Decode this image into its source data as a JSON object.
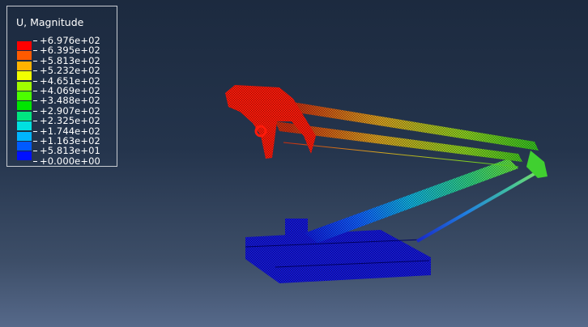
{
  "legend": {
    "title": "U, Magnitude",
    "colors": [
      "#ff0000",
      "#ff5a00",
      "#ffb300",
      "#f2ff00",
      "#a0ff00",
      "#4cff00",
      "#00e600",
      "#00e680",
      "#00e0e0",
      "#00b4ff",
      "#005aff",
      "#0010ff"
    ],
    "values": [
      "+6.976e+02",
      "+6.395e+02",
      "+5.813e+02",
      "+5.232e+02",
      "+4.651e+02",
      "+4.069e+02",
      "+3.488e+02",
      "+2.907e+02",
      "+2.325e+02",
      "+1.744e+02",
      "+1.163e+02",
      "+5.813e+01",
      "+0.000e+00"
    ]
  },
  "model": {
    "frame_color": "#ff1a0a",
    "upper_arm_colors": [
      "#c83010",
      "#d8a020",
      "#88d020",
      "#30c020"
    ],
    "lower_arm_colors": [
      "#1020e0",
      "#1060ff",
      "#10b0e0",
      "#30d080",
      "#60e040"
    ],
    "base_color": "#1418d8",
    "strut_colors": [
      "#1828c8",
      "#2080e0",
      "#40c0a0",
      "#80e060"
    ],
    "tip_color": "#40d030"
  }
}
